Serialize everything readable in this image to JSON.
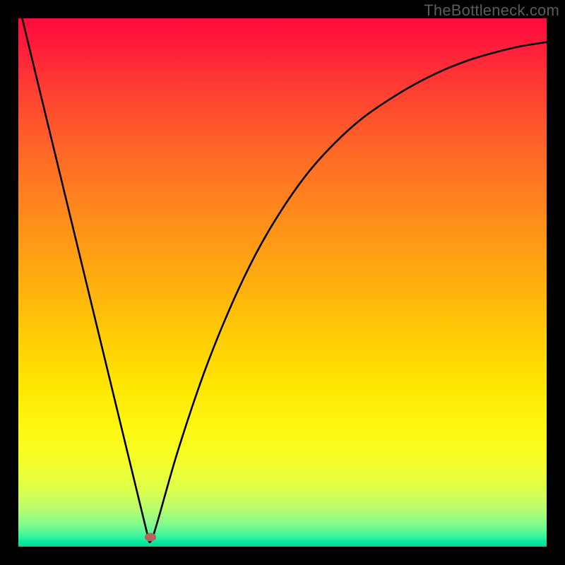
{
  "watermark": "TheBottleneck.com",
  "chart_data": {
    "type": "line",
    "title": "",
    "xlabel": "",
    "ylabel": "",
    "xlim": [
      0,
      1
    ],
    "ylim": [
      0,
      1
    ],
    "grid": false,
    "legend": false,
    "x": [
      0.0,
      0.05,
      0.1,
      0.15,
      0.2,
      0.245,
      0.255,
      0.3,
      0.35,
      0.4,
      0.45,
      0.5,
      0.55,
      0.6,
      0.65,
      0.7,
      0.75,
      0.8,
      0.85,
      0.9,
      0.95,
      1.0
    ],
    "values": [
      1.03,
      0.825,
      0.62,
      0.415,
      0.21,
      0.02,
      0.02,
      0.175,
      0.325,
      0.45,
      0.555,
      0.64,
      0.71,
      0.765,
      0.81,
      0.845,
      0.875,
      0.9,
      0.92,
      0.935,
      0.947,
      0.955
    ],
    "minimum_marker": {
      "x": 0.25,
      "y": 0.018
    },
    "gradient_stops": [
      {
        "pos": 0.0,
        "color": "#ff0a3b"
      },
      {
        "pos": 0.15,
        "color": "#ff4431"
      },
      {
        "pos": 0.38,
        "color": "#ff8d1a"
      },
      {
        "pos": 0.6,
        "color": "#ffcc05"
      },
      {
        "pos": 0.78,
        "color": "#fdf911"
      },
      {
        "pos": 0.89,
        "color": "#e0fe4a"
      },
      {
        "pos": 0.96,
        "color": "#7dfb8e"
      },
      {
        "pos": 1.0,
        "color": "#00d799"
      }
    ],
    "marker_color": "#b96060"
  }
}
